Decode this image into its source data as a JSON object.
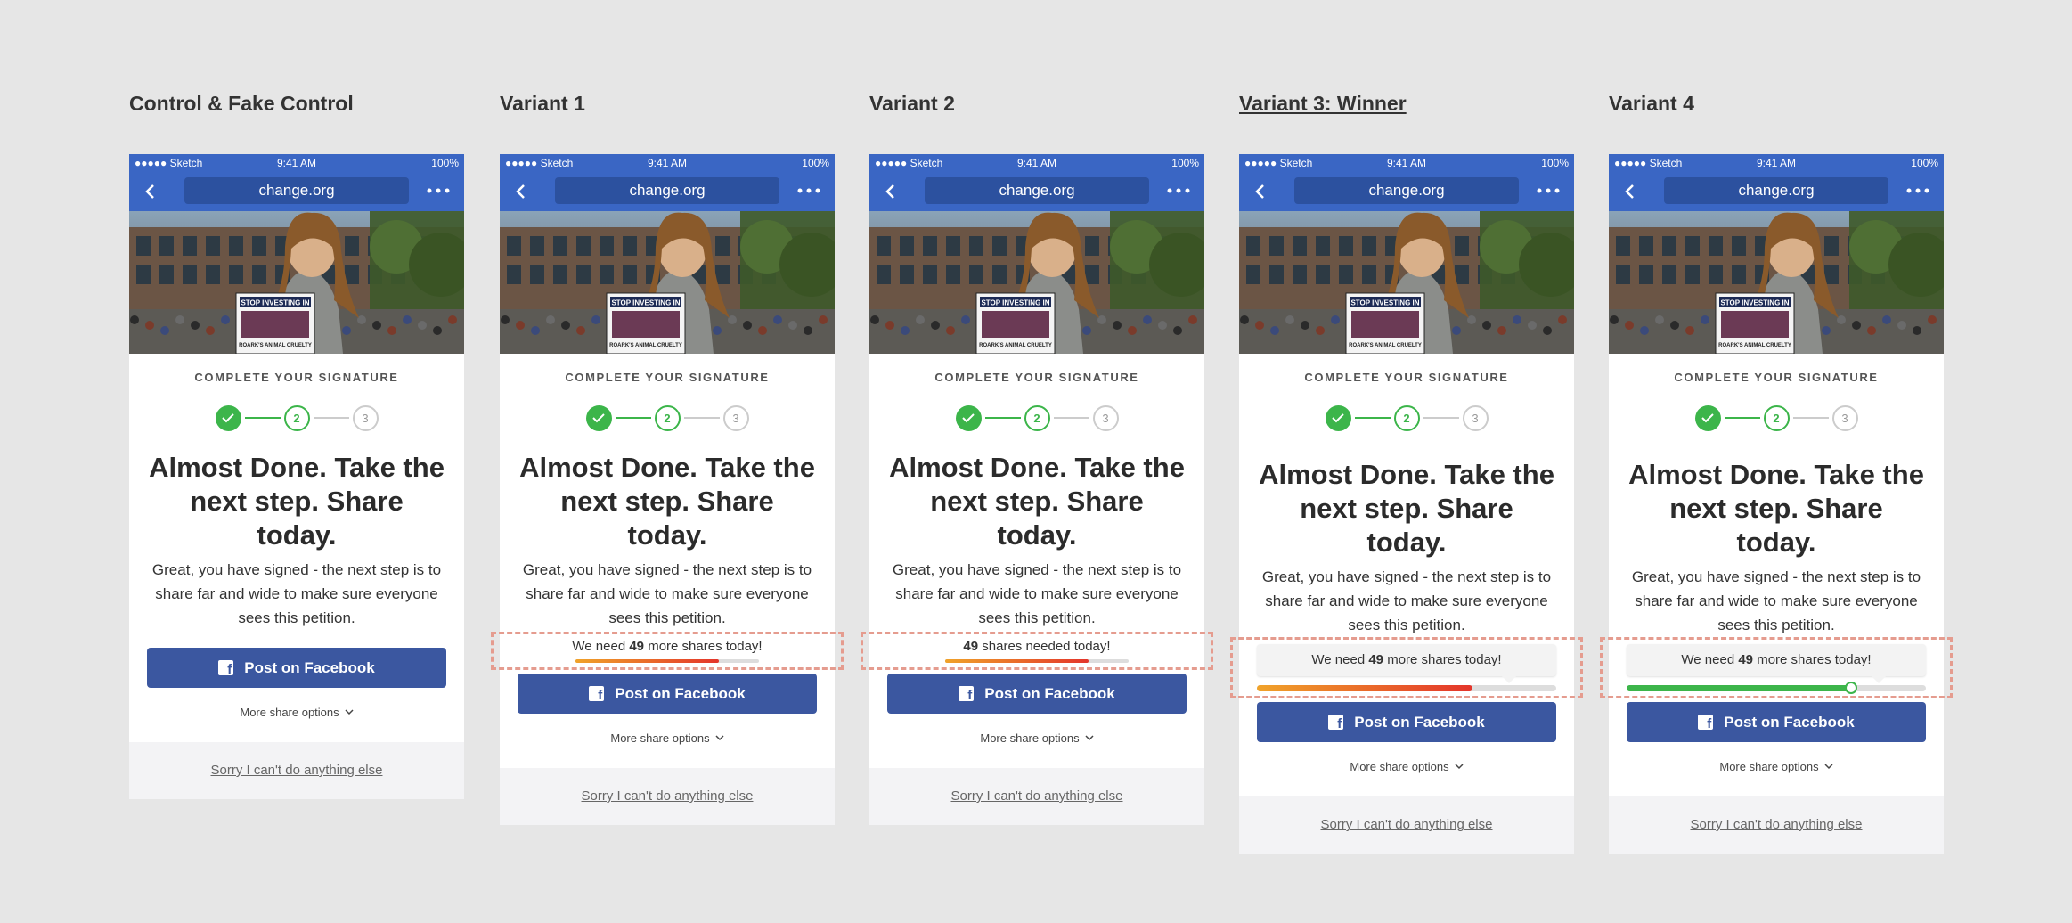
{
  "columns": [
    {
      "title": "Control & Fake Control",
      "variant": "control"
    },
    {
      "title": "Variant 1",
      "variant": "v1",
      "share_prefix": "We need ",
      "share_count": "49",
      "share_suffix": " more shares today!",
      "progress": 0.78
    },
    {
      "title": "Variant 2",
      "variant": "v2",
      "share_prefix": "",
      "share_count": "49",
      "share_suffix": " shares needed today!",
      "progress": 0.78
    },
    {
      "title": "Variant 3: Winner",
      "variant": "v3",
      "share_prefix": "We need ",
      "share_count": "49",
      "share_suffix": " more shares today!",
      "progress": 0.72
    },
    {
      "title": "Variant 4",
      "variant": "v4",
      "share_prefix": "We need ",
      "share_count": "49",
      "share_suffix": " more shares today!",
      "progress": 0.75
    }
  ],
  "phone": {
    "status_left": "●●●●● Sketch",
    "status_time": "9:41 AM",
    "status_battery": "100%",
    "url": "change.org",
    "step_label": "COMPLETE YOUR SIGNATURE",
    "steps": [
      "2",
      "3"
    ],
    "headline": "Almost Done. Take the next step. Share today.",
    "body": "Great, you have signed - the next step is to share far and wide to make sure everyone sees this petition.",
    "fb_button": "Post on Facebook",
    "more_options": "More share options",
    "decline_link": "Sorry I can't do anything else",
    "sign_text": "STOP INVESTING IN",
    "sign_subtext": "ROARK'S ANIMAL CRUELTY"
  },
  "colors": {
    "brand_blue": "#3a66c4",
    "facebook_blue": "#3b57a0",
    "success_green": "#3cb54a",
    "progress_red": "#e4352b",
    "progress_orange": "#f0a32a",
    "highlight_dash": "#e59c8f"
  }
}
